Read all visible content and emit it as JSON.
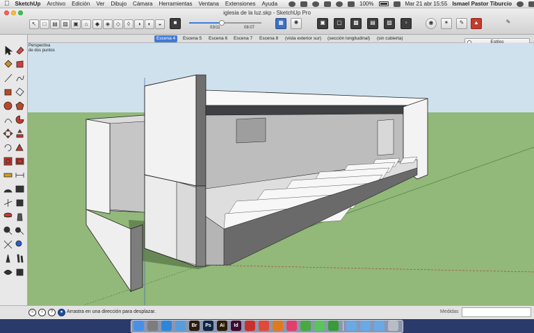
{
  "menubar": {
    "app_name": "SketchUp",
    "items": [
      "Archivo",
      "Edición",
      "Ver",
      "Dibujo",
      "Cámara",
      "Herramientas",
      "Ventana",
      "Extensiones",
      "Ayuda"
    ],
    "battery": "100%",
    "datetime": "Mar 21 abr  15:55",
    "user": "Ismael Pastor Tiburcio"
  },
  "window": {
    "title": "iglesia de la luz.skp - SketchUp Pro",
    "shadow_time_start": "03/11",
    "shadow_time_end": "08:07",
    "shadow_slider_value": 0.45
  },
  "scene_tabs": [
    {
      "label": "Escena 4",
      "active": true
    },
    {
      "label": "Escena 5",
      "active": false
    },
    {
      "label": "Escena 6",
      "active": false
    },
    {
      "label": "Escena 7",
      "active": false
    },
    {
      "label": "Escena 8",
      "active": false
    },
    {
      "label": "(vista exterior sur)",
      "active": false
    },
    {
      "label": "(sección longitudinal)",
      "active": false
    },
    {
      "label": "(sin cubierta)",
      "active": false
    }
  ],
  "styles_panel": {
    "label": "Estilos"
  },
  "viewport": {
    "camera_label": "Perspectiva\nde dos puntos"
  },
  "statusbar": {
    "icon_info": "i",
    "icon_user": "?",
    "message": "Arrastra en una dirección para desplazar.",
    "measure_label": "Medidas",
    "measure_value": ""
  },
  "dock": {
    "apps": [
      {
        "name": "finder-icon",
        "label": "",
        "color": "#4a8fe7"
      },
      {
        "name": "launchpad-icon",
        "label": "",
        "color": "#7d7d7d"
      },
      {
        "name": "safari-icon",
        "label": "",
        "color": "#2f86d8"
      },
      {
        "name": "mail-icon",
        "label": "",
        "color": "#5a9cd9"
      },
      {
        "name": "bridge-icon",
        "label": "Br",
        "color": "#2d1d10"
      },
      {
        "name": "photoshop-icon",
        "label": "Ps",
        "color": "#0f2543"
      },
      {
        "name": "illustrator-icon",
        "label": "Ai",
        "color": "#2e1d06"
      },
      {
        "name": "indesign-icon",
        "label": "Id",
        "color": "#3e0b2e"
      },
      {
        "name": "sketchup-icon",
        "label": "",
        "color": "#c9302c"
      },
      {
        "name": "chrome-icon",
        "label": "",
        "color": "#e04a3a"
      },
      {
        "name": "firefox-icon",
        "label": "",
        "color": "#e07a1f"
      },
      {
        "name": "itunes-icon",
        "label": "",
        "color": "#e23f6b"
      },
      {
        "name": "evernote-icon",
        "label": "",
        "color": "#4aa844"
      },
      {
        "name": "messages-icon",
        "label": "",
        "color": "#5ac55a"
      },
      {
        "name": "facetime-icon",
        "label": "",
        "color": "#3a9b3a"
      },
      {
        "name": "folder-icon",
        "label": "",
        "color": "#6aa8e6"
      },
      {
        "name": "documents-icon",
        "label": "",
        "color": "#6aa8e6"
      },
      {
        "name": "downloads-icon",
        "label": "",
        "color": "#6aa8e6"
      },
      {
        "name": "trash-icon",
        "label": "",
        "color": "#b8bcc4"
      }
    ]
  },
  "colors": {
    "sky": "#cfe1ec",
    "ground": "#92b87a",
    "accent": "#3f7ad5"
  }
}
